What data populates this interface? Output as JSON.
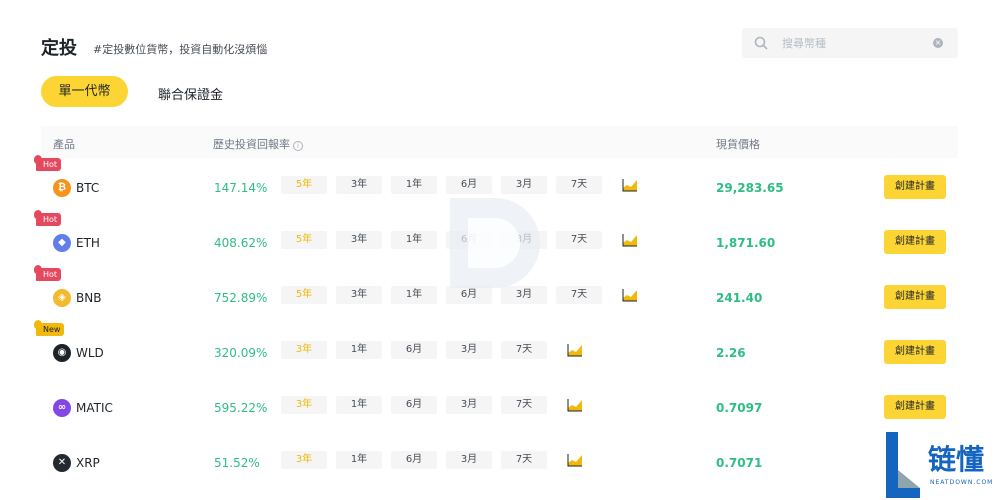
{
  "header": {
    "title": "定投",
    "subtitle": "#定投數位貨幣，投資自動化沒煩惱"
  },
  "search": {
    "placeholder": "搜尋幣種",
    "value": ""
  },
  "tabs": [
    {
      "label": "單一代幣",
      "active": true
    },
    {
      "label": "聯合保證金",
      "active": false
    }
  ],
  "table": {
    "headers": {
      "product": "產品",
      "history": "歷史投資回報率",
      "price": "現貨價格"
    },
    "create_label": "創建計畫",
    "rows": [
      {
        "badge": "Hot",
        "symbol": "BTC",
        "icon": "bitcoin-icon",
        "icon_color": "#f7931a",
        "icon_glyph": "₿",
        "return": "147.14%",
        "periods": [
          "5年",
          "3年",
          "1年",
          "6月",
          "3月",
          "7天"
        ],
        "price": "29,283.65"
      },
      {
        "badge": "Hot",
        "symbol": "ETH",
        "icon": "ethereum-icon",
        "icon_color": "#627eea",
        "icon_glyph": "◆",
        "return": "408.62%",
        "periods": [
          "5年",
          "3年",
          "1年",
          "6月",
          "3月",
          "7天"
        ],
        "price": "1,871.60"
      },
      {
        "badge": "Hot",
        "symbol": "BNB",
        "icon": "bnb-icon",
        "icon_color": "#f3ba2f",
        "icon_glyph": "◈",
        "return": "752.89%",
        "periods": [
          "5年",
          "3年",
          "1年",
          "6月",
          "3月",
          "7天"
        ],
        "price": "241.40"
      },
      {
        "badge": "New",
        "symbol": "WLD",
        "icon": "worldcoin-icon",
        "icon_color": "#1e2329",
        "icon_glyph": "◉",
        "return": "320.09%",
        "periods": [
          "3年",
          "1年",
          "6月",
          "3月",
          "7天"
        ],
        "price": "2.26"
      },
      {
        "badge": "",
        "symbol": "MATIC",
        "icon": "polygon-icon",
        "icon_color": "#8247e5",
        "icon_glyph": "∞",
        "return": "595.22%",
        "periods": [
          "3年",
          "1年",
          "6月",
          "3月",
          "7天"
        ],
        "price": "0.7097"
      },
      {
        "badge": "",
        "symbol": "XRP",
        "icon": "xrp-icon",
        "icon_color": "#23292f",
        "icon_glyph": "✕",
        "return": "51.52%",
        "periods": [
          "3年",
          "1年",
          "6月",
          "3月",
          "7天"
        ],
        "price": "0.7071"
      }
    ]
  },
  "watermark": {
    "brand": "链懂",
    "site": "NEATDOWN.COM"
  },
  "colors": {
    "accent": "#fcd535",
    "positive": "#2ebd85",
    "hot": "#e4495f",
    "new": "#f0b90b"
  }
}
